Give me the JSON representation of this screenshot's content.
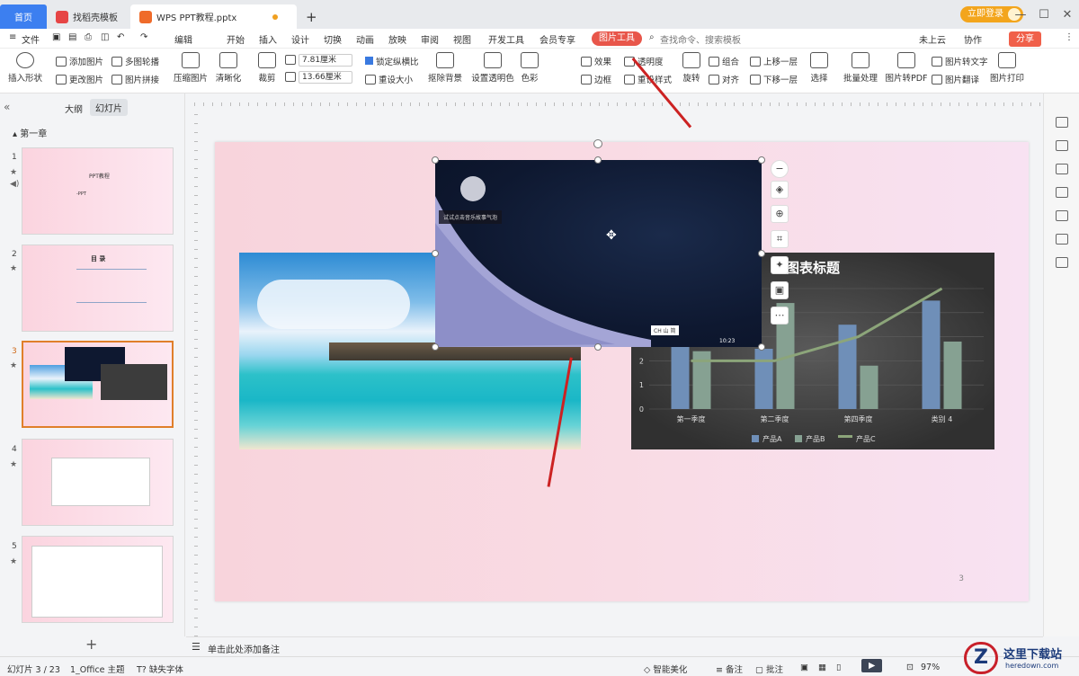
{
  "tabs": {
    "home": "首页",
    "template": "找稻壳模板",
    "doc": "WPS PPT教程.pptx",
    "new_tab": "+"
  },
  "window": {
    "login": "立即登录",
    "min": "—",
    "max": "☐",
    "close": "✕"
  },
  "menu": {
    "file": "文件",
    "edit_mode": "编辑",
    "items": [
      "开始",
      "插入",
      "设计",
      "切换",
      "动画",
      "放映",
      "审阅",
      "视图",
      "开发工具",
      "会员专享"
    ],
    "picture_tools": "图片工具",
    "search": "查找命令、搜索模板",
    "cloud": "未上云",
    "collab": "协作",
    "share": "分享"
  },
  "ribbon": {
    "insert_shape": "插入形状",
    "add_picture": "添加图片",
    "change_picture": "更改图片",
    "multi_outline": "多图轮播",
    "picture_stitch": "图片拼接",
    "compress": "压缩图片",
    "clarity": "清晰化",
    "crop": "裁剪",
    "width": "7.81厘米",
    "height": "13.66厘米",
    "lock_ratio": "锁定纵横比",
    "reset_size": "重设大小",
    "remove_bg": "抠除背景",
    "set_transparent": "设置透明色",
    "color": "色彩",
    "effect": "效果",
    "transparency": "透明度",
    "border": "边框",
    "reset_style": "重设样式",
    "rotate": "旋转",
    "group": "组合",
    "align": "对齐",
    "bring_forward": "上移一层",
    "send_backward": "下移一层",
    "select": "选择",
    "batch": "批量处理",
    "to_pdf": "图片转PDF",
    "to_text": "图片转文字",
    "translate": "图片翻译",
    "print": "图片打印"
  },
  "left_panel": {
    "outline_tab": "大纲",
    "slides_tab": "幻灯片",
    "section": "第一章",
    "slide_numbers": [
      "1",
      "2",
      "3",
      "4",
      "5"
    ],
    "slide1_title": "PPT教程",
    "slide1_sub": "-PPT",
    "slide2_title": "目 录",
    "add_slide": "+"
  },
  "slide": {
    "page_number": "3",
    "video_caption": "试试点击音乐故事气泡",
    "video_time": "10:23",
    "video_ime": "CH 山 简"
  },
  "chart_data": {
    "type": "bar",
    "title": "图表标题",
    "categories": [
      "第一季度",
      "第二季度",
      "第四季度",
      "类别 4"
    ],
    "series": [
      {
        "name": "产品A",
        "values": [
          4.3,
          2.5,
          3.5,
          4.5
        ],
        "color": "#6f8fb8"
      },
      {
        "name": "产品B",
        "values": [
          2.4,
          4.4,
          1.8,
          2.8
        ],
        "color": "#86a192"
      },
      {
        "name": "产品C",
        "values": [
          2,
          2,
          3,
          5
        ],
        "color": "#8ca57a",
        "kind": "line"
      }
    ],
    "yticks": [
      "0",
      "1",
      "2",
      "3"
    ],
    "ylim": [
      0,
      5
    ],
    "legend": "bottom"
  },
  "notes": {
    "placeholder": "单击此处添加备注"
  },
  "status": {
    "slide_count": "幻灯片 3 / 23",
    "theme": "1_Office 主题",
    "missing_font": "缺失字体",
    "beautify": "智能美化",
    "notes": "备注",
    "comments": "批注",
    "zoom": "97%"
  },
  "watermark": {
    "text": "这里下载站",
    "domain": "heredown.com"
  }
}
